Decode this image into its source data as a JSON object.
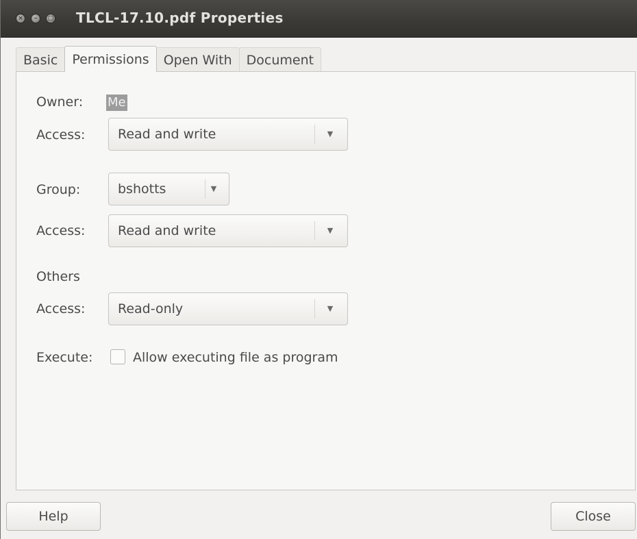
{
  "window": {
    "title": "TLCL-17.10.pdf Properties"
  },
  "tabs": [
    {
      "label": "Basic",
      "active": false
    },
    {
      "label": "Permissions",
      "active": true
    },
    {
      "label": "Open With",
      "active": false
    },
    {
      "label": "Document",
      "active": false
    }
  ],
  "permissions": {
    "owner_label": "Owner:",
    "owner_value": "Me",
    "owner_access_label": "Access:",
    "owner_access_value": "Read and write",
    "group_label": "Group:",
    "group_value": "bshotts",
    "group_access_label": "Access:",
    "group_access_value": "Read and write",
    "others_label": "Others",
    "others_access_label": "Access:",
    "others_access_value": "Read-only",
    "execute_label": "Execute:",
    "execute_checkbox_label": "Allow executing file as program",
    "execute_checked": false
  },
  "buttons": {
    "help": "Help",
    "close": "Close"
  },
  "icons": {
    "close": "close-icon",
    "minimize": "minimize-icon",
    "maximize": "maximize-icon",
    "dropdown": "chevron-down-icon"
  }
}
